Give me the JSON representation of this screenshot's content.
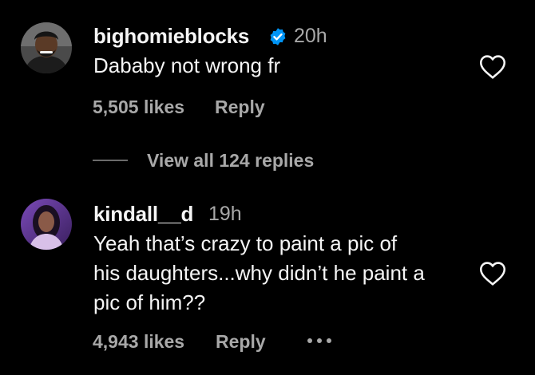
{
  "comments": [
    {
      "username": "bighomieblocks",
      "verified": true,
      "time": "20h",
      "text": "Dababy not wrong fr",
      "likes": "5,505 likes",
      "reply_label": "Reply",
      "view_replies": "View all 124 replies",
      "avatar_icon": "person-avatar"
    },
    {
      "username": "kindall__d",
      "verified": false,
      "time": "19h",
      "text_lines": [
        "Yeah that’s crazy to paint a pic of",
        "his daughters...why didn’t he paint a",
        "pic of him??"
      ],
      "likes": "4,943 likes",
      "reply_label": "Reply",
      "avatar_icon": "person-avatar"
    }
  ],
  "colors": {
    "background": "#000000",
    "primary_text": "#f5f5f5",
    "secondary_text": "#a8a8a8",
    "verified_badge": "#0095f6"
  },
  "icons": {
    "like": "heart-outline-icon",
    "verified": "verified-badge-icon",
    "more": "more-horizontal-icon"
  }
}
